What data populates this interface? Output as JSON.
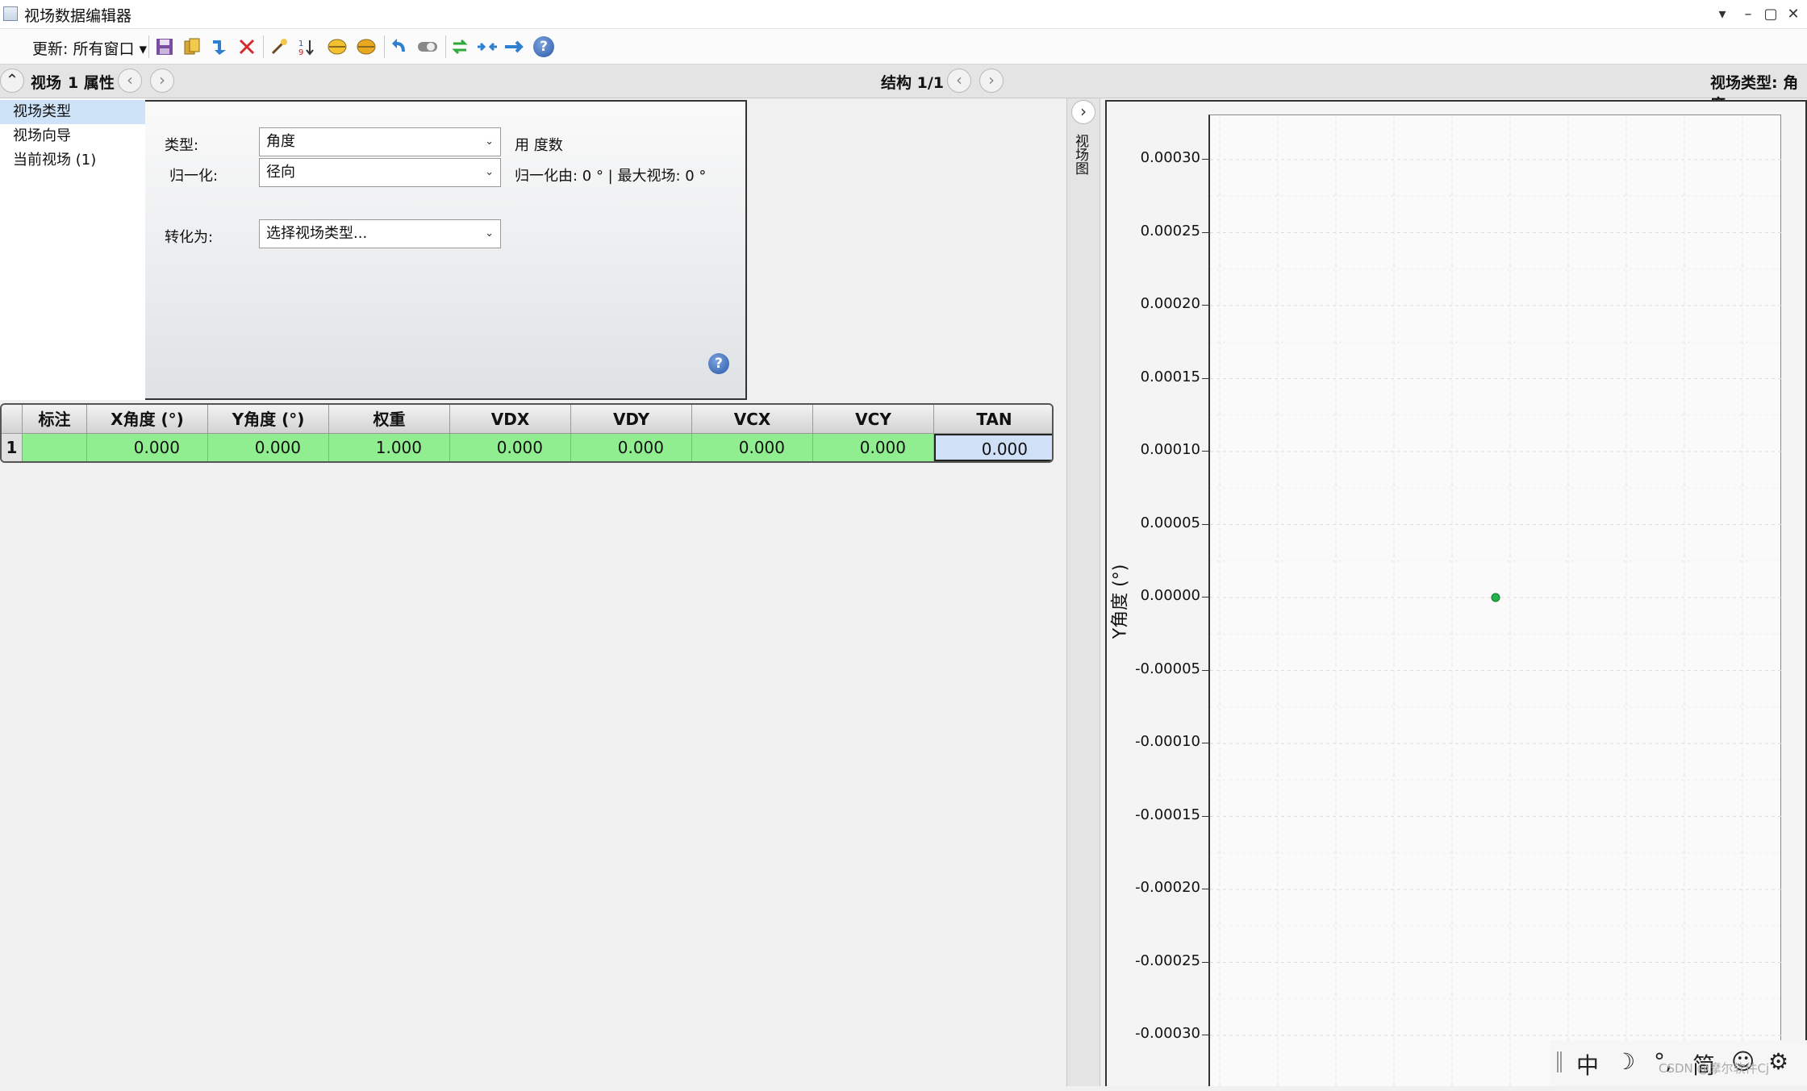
{
  "window": {
    "title": "视场数据编辑器"
  },
  "toolbar": {
    "update_label": "更新: 所有窗口",
    "icons": [
      "save-icon",
      "copy-icon",
      "import-icon",
      "delete-icon",
      "wand-icon",
      "sort-icon",
      "ellipse-icon",
      "ellipse-filled-icon",
      "undo-icon",
      "toggle-icon",
      "swap-icon",
      "collapse-icon",
      "forward-icon",
      "help-icon"
    ]
  },
  "nav": {
    "left_title": "视场",
    "left_count": "1 属性",
    "center": "结构 1/1",
    "right": "视场类型: 角度"
  },
  "leftlist": {
    "items": [
      "视场类型",
      "视场向导",
      "当前视场 (1)"
    ]
  },
  "props": {
    "type_label": "类型:",
    "type_value": "角度",
    "type_unit": "用 度数",
    "norm_label": "归一化:",
    "norm_value": "径向",
    "norm_info": "归一化由: 0 ° | 最大视场: 0 °",
    "convert_label": "转化为:",
    "convert_placeholder": "选择视场类型..."
  },
  "grid": {
    "headers": [
      "标注",
      "X角度 (°)",
      "Y角度 (°)",
      "权重",
      "VDX",
      "VDY",
      "VCX",
      "VCY",
      "TAN"
    ],
    "rows": [
      {
        "num": "1",
        "cells": [
          "",
          "0.000",
          "0.000",
          "1.000",
          "0.000",
          "0.000",
          "0.000",
          "0.000",
          "0.000"
        ]
      }
    ]
  },
  "side_tab": "视场图",
  "chart_data": {
    "type": "scatter",
    "ylabel": "Y角度 (°)",
    "ylim": [
      -0.0003,
      0.0003
    ],
    "yticks": [
      "0.00030",
      "0.00025",
      "0.00020",
      "0.00015",
      "0.00010",
      "0.00005",
      "0.00000",
      "-0.00005",
      "-0.00010",
      "-0.00015",
      "-0.00020",
      "-0.00025",
      "-0.00030"
    ],
    "points": [
      {
        "x": 0,
        "y": 0
      }
    ],
    "point_color": "#22b14c",
    "grid": true
  },
  "ime": {
    "items": [
      "中",
      "☽",
      "°,",
      "简",
      "☺",
      "⚙"
    ]
  },
  "watermark": "CSDN @摩尔软件Cj"
}
